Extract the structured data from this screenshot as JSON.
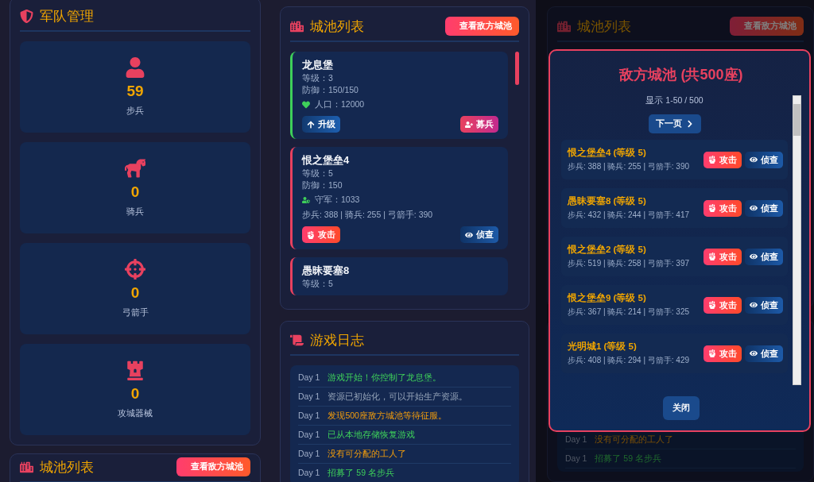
{
  "army": {
    "title": "军队管理",
    "units": [
      {
        "kind": "infantry",
        "count": "59",
        "label": "步兵"
      },
      {
        "kind": "cavalry",
        "count": "0",
        "label": "骑兵"
      },
      {
        "kind": "archer",
        "count": "0",
        "label": "弓箭手"
      },
      {
        "kind": "siege",
        "count": "0",
        "label": "攻城器械"
      }
    ]
  },
  "lower_panel": {
    "title": "城池列表",
    "enemy_button": "查看敌方城池"
  },
  "cities": {
    "title": "城池列表",
    "enemy_button": "查看敌方城池",
    "items": [
      {
        "color": "#3ecf5a",
        "name": "龙息堡",
        "lines": [
          "等级：3",
          "防御：150/150"
        ],
        "stat": {
          "kind": "population",
          "text": "人口：12000"
        },
        "actions": [
          {
            "kind": "upgrade",
            "label": "升级"
          },
          {
            "kind": "recruit",
            "label": "募兵"
          }
        ]
      },
      {
        "color": "#e8415f",
        "name": "恨之堡垒4",
        "lines": [
          "等级：5",
          "防御：150"
        ],
        "stat": {
          "kind": "garrison",
          "text": "守军：1033"
        },
        "troops": "步兵: 388 | 骑兵: 255 | 弓箭手: 390",
        "actions": [
          {
            "kind": "attack",
            "label": "攻击"
          },
          {
            "kind": "scout",
            "label": "侦查"
          }
        ]
      },
      {
        "color": "#e8415f",
        "name": "愚昧要塞8",
        "lines": [
          "等级：5"
        ]
      }
    ]
  },
  "log": {
    "title": "游戏日志",
    "entries": [
      {
        "day": "Day 1",
        "text": "游戏开始！你控制了龙息堡。",
        "kind": "success"
      },
      {
        "day": "Day 1",
        "text": "资源已初始化，可以开始生产资源。",
        "kind": "info"
      },
      {
        "day": "Day 1",
        "text": "发现500座敌方城池等待征服。",
        "kind": "warning"
      },
      {
        "day": "Day 1",
        "text": "已从本地存储恢复游戏",
        "kind": "success"
      },
      {
        "day": "Day 1",
        "text": "没有可分配的工人了",
        "kind": "warning"
      },
      {
        "day": "Day 1",
        "text": "招募了 59 名步兵",
        "kind": "success"
      }
    ]
  },
  "background": {
    "title": "城池列表",
    "enemy_button": "查看敌方城池",
    "log_entries": [
      {
        "day": "Day 1",
        "text": "没有可分配的工人了",
        "kind": "warning"
      },
      {
        "day": "Day 1",
        "text": "招募了 59 名步兵",
        "kind": "success"
      }
    ]
  },
  "modal": {
    "title": "敌方城池 (共500座)",
    "range": "显示 1-50 / 500",
    "next": "下一页",
    "close": "关闭",
    "cities": [
      {
        "name": "恨之堡垒4 (等级 5)",
        "troops": "步兵: 388 | 骑兵: 255 | 弓箭手: 390",
        "attack": "攻击",
        "scout": "侦查"
      },
      {
        "name": "愚昧要塞8 (等级 5)",
        "troops": "步兵: 432 | 骑兵: 244 | 弓箭手: 417",
        "attack": "攻击",
        "scout": "侦查"
      },
      {
        "name": "恨之堡垒2 (等级 5)",
        "troops": "步兵: 519 | 骑兵: 258 | 弓箭手: 397",
        "attack": "攻击",
        "scout": "侦查"
      },
      {
        "name": "恨之堡垒9 (等级 5)",
        "troops": "步兵: 367 | 骑兵: 214 | 弓箭手: 325",
        "attack": "攻击",
        "scout": "侦查"
      },
      {
        "name": "光明城1 (等级 5)",
        "troops": "步兵: 408 | 骑兵: 294 | 弓箭手: 429",
        "attack": "攻击",
        "scout": "侦查"
      }
    ]
  }
}
